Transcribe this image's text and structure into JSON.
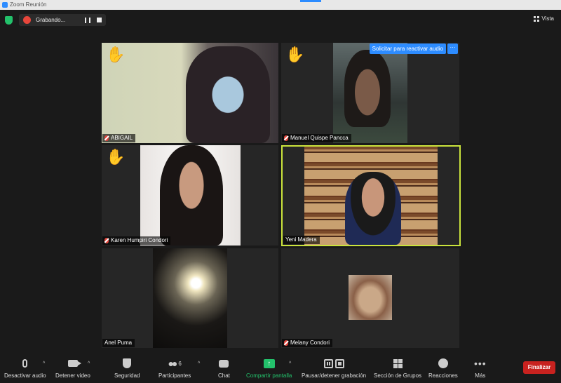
{
  "window": {
    "title": "Zoom Reunión"
  },
  "topbar": {
    "recording_label": "Grabando...",
    "view_label": "Vista"
  },
  "participants": [
    {
      "name": "ABIGAIL",
      "hand_raised": true,
      "muted": true
    },
    {
      "name": "Manuel Quispe Pancca",
      "hand_raised": true,
      "muted": true
    },
    {
      "name": "Karen Humpiri Condori",
      "hand_raised": true,
      "muted": true
    },
    {
      "name": "Yeni Madera",
      "hand_raised": false,
      "muted": false,
      "active_speaker": true
    },
    {
      "name": "Anel Puma",
      "hand_raised": false,
      "muted": false
    },
    {
      "name": "Melany Condori",
      "hand_raised": false,
      "muted": true
    }
  ],
  "tile_actions": {
    "request_unmute": "Solicitar para reactivar audio",
    "more": "···"
  },
  "hand_icon": "✋",
  "toolbar": {
    "mute_audio": "Desactivar audio",
    "stop_video": "Detener video",
    "security": "Seguridad",
    "participants": "Participantes",
    "participants_count": "6",
    "chat": "Chat",
    "share_screen": "Compartir pantalla",
    "pause_stop_recording": "Pausar/detener grabación",
    "breakout_rooms": "Sección de Grupos",
    "reactions": "Reacciones",
    "more": "Más",
    "end": "Finalizar",
    "caret": "^",
    "more_dots": "•••"
  },
  "colors": {
    "accent_blue": "#2d8cff",
    "share_green": "#23c16b",
    "end_red": "#c8221f",
    "active_speaker_border": "#cbe43c",
    "muted_red": "#e0443b"
  }
}
